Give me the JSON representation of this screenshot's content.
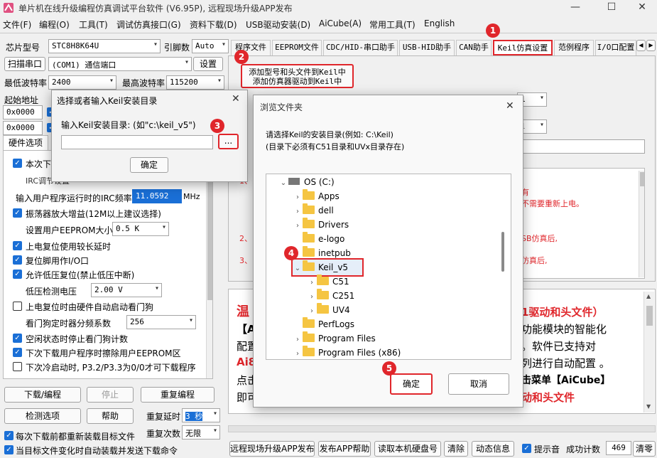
{
  "app": {
    "title": "单片机在线升级编程仿真调试平台软件 (V6.95P), 远程现场升级APP发布",
    "win_min": "—",
    "win_max": "☐",
    "win_close": "✕"
  },
  "menu": [
    "文件(F)",
    "编程(O)",
    "工具(T)",
    "调试仿真接口(G)",
    "资料下载(D)",
    "USB驱动安装(D)",
    "AiCube(A)",
    "常用工具(T)",
    "English"
  ],
  "left": {
    "chip_label": "芯片型号",
    "chip_value": "STC8H8K64U",
    "pin_label": "引脚数",
    "pin_value": "Auto",
    "scan_btn": "扫描串口",
    "port_value": "(COM1) 通信端口",
    "settings_btn": "设置",
    "min_baud_label": "最低波特率",
    "min_baud_value": "2400",
    "max_baud_label": "最高波特率",
    "max_baud_value": "115200",
    "start_addr_label": "起始地址",
    "addr1": "0x0000",
    "addr2": "0x0000",
    "hw_tab": "硬件选项",
    "options": [
      {
        "text": "本次下载",
        "checked": true
      },
      {
        "text": "IRC调节设置",
        "checked": null
      },
      {
        "text": "输入用户程序运行时的IRC频率",
        "checked": null
      },
      {
        "text": "振荡器放大增益(12M以上建议选择)",
        "checked": true
      },
      {
        "text": "设置用户EEPROM大小",
        "checked": null
      },
      {
        "text": "上电复位使用较长延时",
        "checked": true
      },
      {
        "text": "复位脚用作I/O口",
        "checked": true
      },
      {
        "text": "允许低压复位(禁止低压中断)",
        "checked": true
      },
      {
        "text": "低压检测电压",
        "checked": null
      },
      {
        "text": "上电复位时由硬件自动启动看门狗",
        "checked": false
      },
      {
        "text": "看门狗定时器分频系数",
        "checked": null
      },
      {
        "text": "空闲状态时停止看门狗计数",
        "checked": true
      },
      {
        "text": "下次下载用户程序时擦除用户EEPROM区",
        "checked": true
      },
      {
        "text": "下次冷启动时, P3.2/P3.3为0/0才可下载程序",
        "checked": false
      }
    ],
    "irc_freq_value": "11.0592",
    "irc_unit": "MHz",
    "eeprom_value": "0.5 K",
    "lv_value": "2.00 V",
    "wdt_value": "256",
    "download_btn": "下载/编程",
    "stop_btn": "停止",
    "reprogram_btn": "重复编程",
    "detect_btn": "检测选项",
    "help_btn": "帮助",
    "delay_label": "重复延时",
    "delay_value": "3 秒",
    "count_label": "重复次数",
    "count_value": "无限",
    "reload_text": "每次下载前都重新装载目标文件",
    "autoload_text": "当目标文件变化时自动装载并发送下载命令"
  },
  "tabs": [
    "程序文件",
    "EEPROM文件",
    "CDC/HID-串口助手",
    "USB-HID助手",
    "CAN助手",
    "Keil仿真设置",
    "范例程序",
    "I/O口配置"
  ],
  "keil": {
    "add_btn_line1": "添加型号和头文件到Keil中",
    "add_btn_line2": "添加仿真器驱动到Keil中",
    "red_lines": [
      "有",
      "不需要重新上电。",
      "SB仿真后,",
      "仿真后,"
    ],
    "num2": "2、",
    "num3": "3、",
    "num1": "1、"
  },
  "notice": {
    "title_left": "温",
    "title_right": "1驱动和头文件）",
    "line1_left": "【A",
    "line1_right": "功能模块的智能化",
    "line2_left": "配置",
    "line2_right": "。软件已支持对",
    "line3_left": "Ai8",
    "line3_right": "列进行自动配置 。",
    "line4_left": "点击",
    "line4_right": "击菜单【AiCube】",
    "line5_left": "即可",
    "line5_right": "动和头文件"
  },
  "bottom": {
    "btn1": "远程现场升级APP发布",
    "btn2": "发布APP帮助",
    "btn3": "读取本机硬盘号",
    "btn4": "清除",
    "btn5": "动态信息",
    "sound": "提示音",
    "count_label": "成功计数",
    "count_value": "469",
    "reset_btn": "清零"
  },
  "keil_dialog": {
    "title": "选择或者输入Keil安装目录",
    "prompt": "输入Keil安装目录: (如\"c:\\keil_v5\")",
    "path_value": "",
    "browse": "...",
    "ok": "确定"
  },
  "browse_dialog": {
    "title": "浏览文件夹",
    "line1": "请选择Keil的安装目录(例如: C:\\Keil)",
    "line2": "(目录下必须有C51目录和UVx目录存在)",
    "tree": [
      {
        "label": "OS (C:)",
        "level": 0,
        "expanded": true,
        "drive": true
      },
      {
        "label": "Apps",
        "level": 1,
        "expanded": false
      },
      {
        "label": "dell",
        "level": 1,
        "expanded": false
      },
      {
        "label": "Drivers",
        "level": 1,
        "expanded": false
      },
      {
        "label": "e-logo",
        "level": 1,
        "expanded": null
      },
      {
        "label": "inetpub",
        "level": 1,
        "expanded": null
      },
      {
        "label": "Keil_v5",
        "level": 1,
        "expanded": true,
        "selected": true
      },
      {
        "label": "C51",
        "level": 2,
        "expanded": false
      },
      {
        "label": "C251",
        "level": 2,
        "expanded": false
      },
      {
        "label": "UV4",
        "level": 2,
        "expanded": false
      },
      {
        "label": "PerfLogs",
        "level": 1,
        "expanded": null
      },
      {
        "label": "Program Files",
        "level": 1,
        "expanded": false
      },
      {
        "label": "Program Files (x86)",
        "level": 1,
        "expanded": false
      }
    ],
    "ok": "确定",
    "cancel": "取消"
  },
  "callouts": [
    "1",
    "2",
    "3",
    "4",
    "5"
  ],
  "colors": {
    "accent_red": "#e0262b",
    "check_blue": "#1a6fd6",
    "folder": "#f5c542"
  }
}
